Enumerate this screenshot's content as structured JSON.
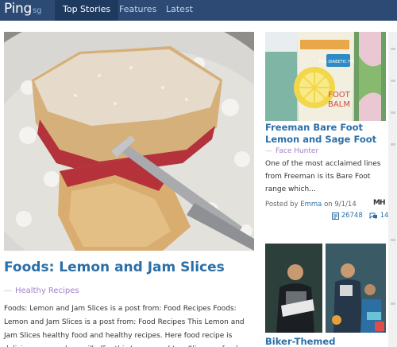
{
  "nav": {
    "logo_main": "Ping",
    "logo_suffix": "sg",
    "tabs": [
      {
        "label": "Top Stories",
        "active": true
      },
      {
        "label": "Features",
        "active": false
      },
      {
        "label": "Latest",
        "active": false
      }
    ]
  },
  "main_article": {
    "image_icon": "jam-slice-photo",
    "title": "Foods: Lemon and Jam Slices",
    "category_dash": "—",
    "category": "Healthy Recipes",
    "excerpt": "Foods: Lemon and Jam Slices is a post from: Food Recipes Foods: Lemon and Jam Slices is a post from: Food Recipes This Lemon and Jam Slices healthy food and healthy recipes. Here food recipe is delicious, we spel we will offer this Lemon and Jam Slices on food"
  },
  "side_card_1": {
    "image_icon": "foot-balm-product-photo",
    "image_text_1": "FOOT",
    "image_text_2": "BALM",
    "image_text_3": "FOR DIABETIC FEET",
    "title": "Freeman Bare Foot Lemon and Sage Foot",
    "category_dash": "—",
    "category": "Face Hunter",
    "excerpt": "One of the most acclaimed lines from Freeman is its Bare Foot range which...",
    "posted_prefix": "Posted by",
    "author": "Emma",
    "posted_on": "on 9/1/14",
    "source_logo": "MH",
    "views": "26748",
    "comments": "14"
  },
  "side_card_2": {
    "image_icon": "biker-group-photo",
    "title": "Biker-Themed"
  },
  "colors": {
    "nav_bg": "#2c4a74",
    "nav_active": "#1f3a5f",
    "link_blue": "#2a6fa8",
    "category_purple": "#a37fc7"
  }
}
